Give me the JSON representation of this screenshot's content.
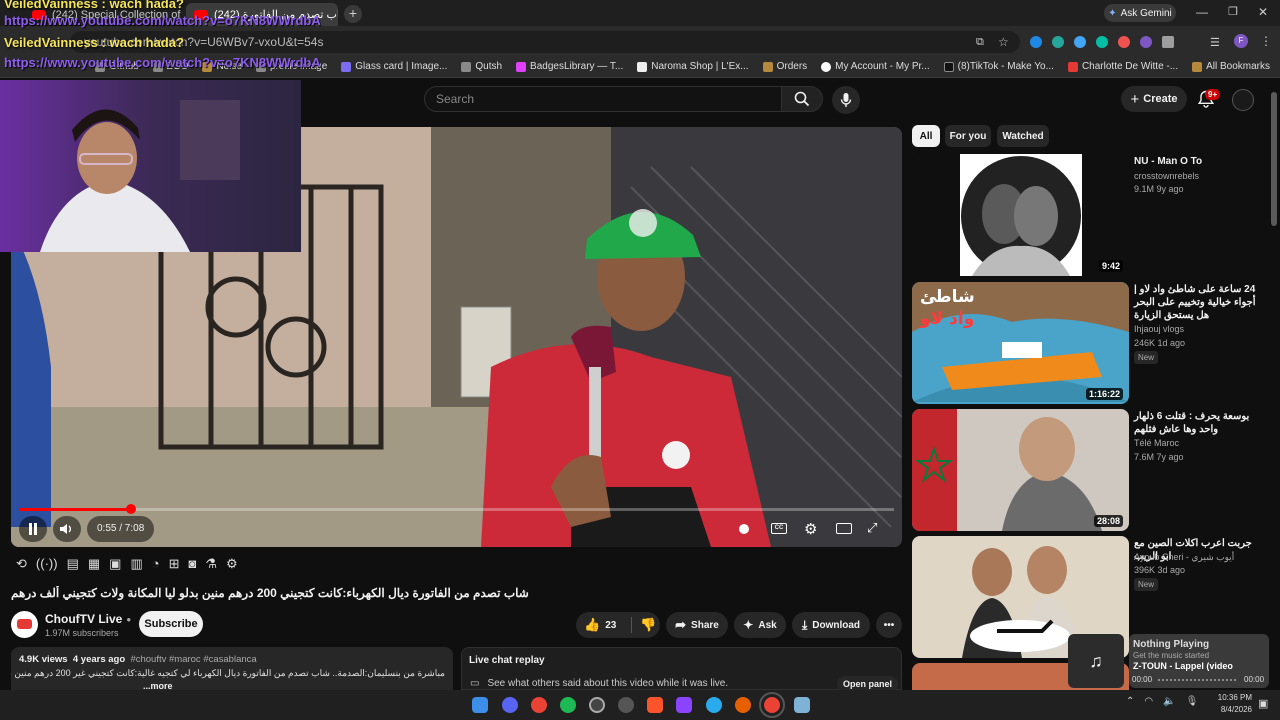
{
  "overlay": {
    "name1": "VeiledVainness : wach hada?",
    "url1": "https://www.youtube.com/watch?v=o7KN8WWrdbA",
    "name2": "VeiledVainness : wach hada?",
    "url2": "https://www.youtube.com/watch?v=o7KN8WWrdbA"
  },
  "browser": {
    "tabs": [
      {
        "label": "(242) Special Collection of Mo..."
      },
      {
        "label": "(242) شاب تصدم من الفاتورة"
      }
    ],
    "url": "youtube.com/watch?v=U6WBv7-vxoU&t=54s",
    "ask_gemini": "Ask Gemini",
    "bookmarks": [
      "Github",
      "ZGO",
      "Noise",
      "profile image",
      "Glass card | Image...",
      "Qutsh",
      "BadgesLibrary — T...",
      "Naroma Shop | L'Ex...",
      "Orders",
      "My Account - My Pr...",
      "(8)TikTok - Make Yo...",
      "Charlotte De Witte -..."
    ],
    "all_bookmarks": "All Bookmarks"
  },
  "header": {
    "search_placeholder": "Search",
    "create_label": "Create",
    "notif_count": "9+"
  },
  "player": {
    "time": "0:55 / 7:08",
    "progress": 0.128
  },
  "video": {
    "title": "شاب تصدم من الفاتورة ديال الكهرباء:كانت كتجيني 200 درهم منين بدلو ليا المكانة ولات كتجيني ألف درهم",
    "channel": "ChoufTV Live",
    "subscribers": "1.97M subscribers",
    "subscribe_label": "Subscribe",
    "likes": "23",
    "share_label": "Share",
    "ask_label": "Ask",
    "download_label": "Download",
    "views": "4.9K views",
    "age": "4 years ago",
    "tags": "#chouftv #maroc #casablanca",
    "description": "مباشرة من بنسليمان:الصدمة.. شاب تصدم من الفاتورة ديال الكهرباء لي كتجيه غالية:كانت كتجيني غير 200 درهم منين بدلو ليا المكانة ولات",
    "more_label": "...more"
  },
  "chat": {
    "title": "Live chat replay",
    "subtitle": "See what others said about this video while it was live.",
    "open_panel": "Open panel"
  },
  "filters": [
    {
      "label": "All",
      "active": true
    },
    {
      "label": "For you",
      "active": false
    },
    {
      "label": "Watched",
      "active": false
    }
  ],
  "recommendations": [
    {
      "title": "NU - Man O To",
      "channel": "crosstownrebels",
      "meta": "9.1M  9y ago",
      "duration": "9:42",
      "new": ""
    },
    {
      "title": "24 ساعة على شاطئ واد لاو | أجواء خيالية وتخييم على البحر هل يستحق الزيارة",
      "channel": "Ihjaouj vlogs",
      "meta": "246K  1d ago",
      "duration": "1:16:22",
      "new": "New",
      "thumb_text_1": "شاطئ",
      "thumb_text_2": "واد لاو"
    },
    {
      "title": "بوسعة يحرف : قتلت 6 ذلهار واحد وها عاش فثلهم",
      "channel": "Télé Maroc",
      "meta": "7.6M  7y ago",
      "duration": "28:08",
      "new": ""
    },
    {
      "title": "جربت اعرب اكلات الصين مع ابو الريب",
      "channel": "Ayoub Cheri - أيوب شيري",
      "meta": "396K  3d ago",
      "duration": "",
      "new": "New"
    }
  ],
  "now_playing": {
    "title": "Nothing Playing",
    "subtitle": "Get the music started",
    "track_peek": "Z-TOUN - Lappel (video",
    "t_start": "00:00",
    "t_end": "00:00"
  },
  "taskbar": {
    "time": "10:36 PM",
    "date": "8/4/2026"
  },
  "colors": {
    "yt_red": "#ff0000",
    "overlay_name": "#f5e45a",
    "overlay_url": "#8e5cf0"
  }
}
